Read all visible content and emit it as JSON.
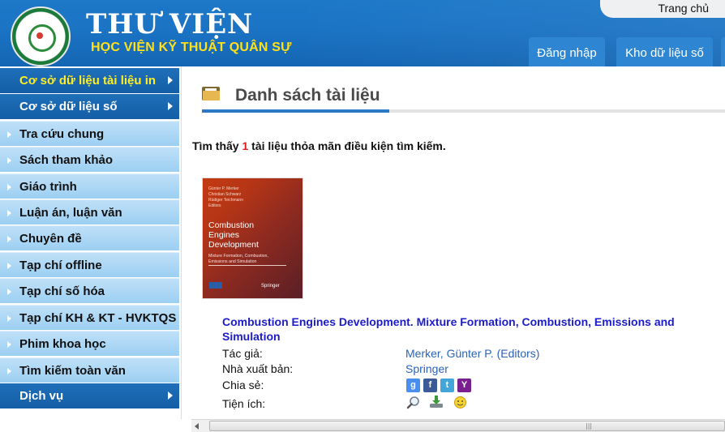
{
  "header": {
    "title": "THƯ VIỆN",
    "subtitle": "HỌC VIỆN KỸ THUẬT QUÂN SỰ",
    "home_link": "Trang chủ",
    "login_button": "Đăng nhập",
    "digital_repo_button": "Kho dữ liệu số"
  },
  "sidebar": {
    "items": [
      {
        "label": "Cơ sở dữ liệu tài liệu in",
        "style": "dark",
        "active": true
      },
      {
        "label": "Cơ sở dữ liệu số",
        "style": "dark",
        "active": false
      },
      {
        "label": "Tra cứu chung",
        "style": "light"
      },
      {
        "label": "Sách tham khảo",
        "style": "light"
      },
      {
        "label": "Giáo trình",
        "style": "light"
      },
      {
        "label": "Luận án, luận văn",
        "style": "light"
      },
      {
        "label": "Chuyên đề",
        "style": "light"
      },
      {
        "label": "Tạp chí offline",
        "style": "light"
      },
      {
        "label": "Tạp chí số hóa",
        "style": "light"
      },
      {
        "label": "Tạp chí KH & KT - HVKTQS",
        "style": "light"
      },
      {
        "label": "Phim khoa học",
        "style": "light"
      },
      {
        "label": "Tìm kiếm toàn văn",
        "style": "light"
      },
      {
        "label": "Dịch vụ",
        "style": "dark",
        "active": false
      }
    ]
  },
  "main": {
    "section_title": "Danh sách tài liệu",
    "result": {
      "prefix": "Tìm thấy ",
      "count": "1",
      "suffix": " tài liệu thỏa mãn điều kiện tìm kiếm."
    },
    "cover": {
      "authors_line1": "Günter P. Merker",
      "authors_line2": "Christian Schwarz",
      "authors_line3": "Rüdiger Teichmann",
      "authors_line4": "Editors",
      "title_line1": "Combustion",
      "title_line2": "Engines",
      "title_line3": "Development",
      "subtitle_line1": "Mixture Formation, Combustion,",
      "subtitle_line2": "Emissions and Simulation",
      "publisher_logo": "Springer"
    },
    "book": {
      "title": "Combustion Engines Development. Mixture Formation, Combustion, Emissions and Simulation",
      "author_label": "Tác giả:",
      "author_value": "Merker, Günter P. (Editors)",
      "publisher_label": "Nhà xuất bản:",
      "publisher_value": "Springer",
      "share_label": "Chia sẻ:",
      "tools_label": "Tiện ích:"
    },
    "share_icons": [
      {
        "name": "google-share-icon",
        "glyph": "g",
        "color": "#4a8ff0"
      },
      {
        "name": "facebook-share-icon",
        "glyph": "f",
        "color": "#3b5a9a"
      },
      {
        "name": "twitter-share-icon",
        "glyph": "t",
        "color": "#43a6d9"
      },
      {
        "name": "yahoo-share-icon",
        "glyph": "Y",
        "color": "#7a1f8f"
      }
    ]
  }
}
